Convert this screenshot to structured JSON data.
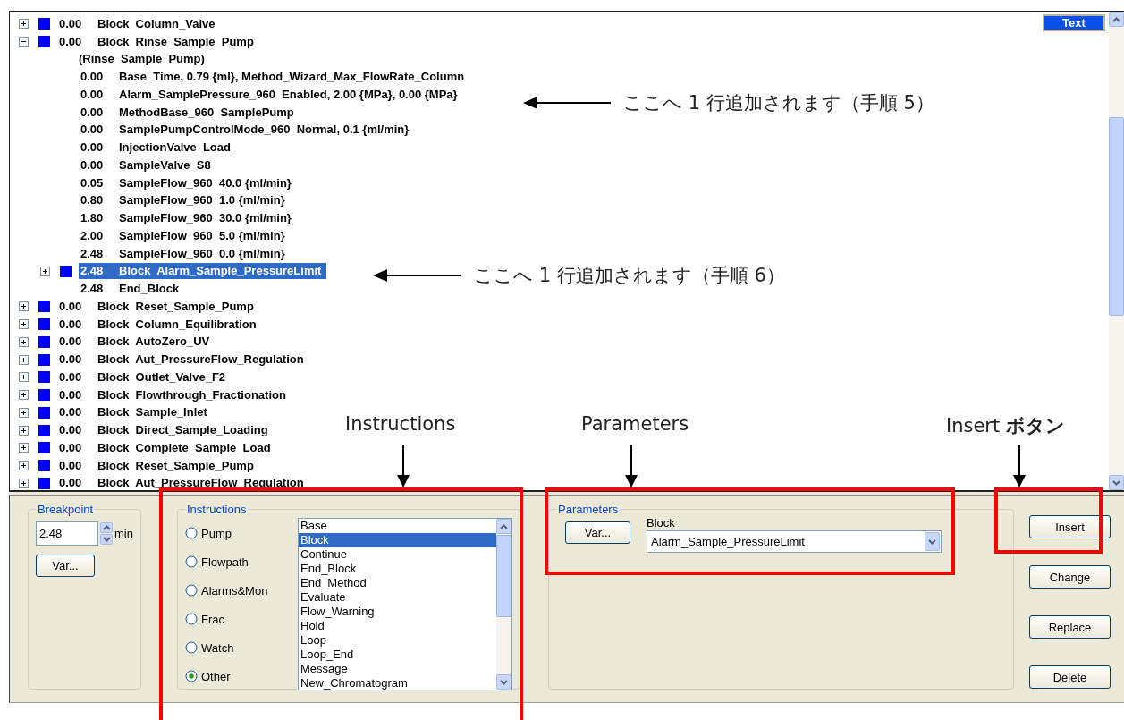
{
  "tree": [
    {
      "kind": "block",
      "time": "0.00",
      "text": "Block  Column_Valve",
      "expanded": false,
      "selected": false
    },
    {
      "kind": "block",
      "time": "0.00",
      "text": "Block  Rinse_Sample_Pump",
      "expanded": true,
      "selected": false,
      "children": [
        {
          "kind": "label",
          "text": "(Rinse_Sample_Pump)",
          "selected": false
        },
        {
          "kind": "step",
          "time": "0.00",
          "text": "Base  Time, 0.79 {ml}, Method_Wizard_Max_FlowRate_Column",
          "selected": false
        },
        {
          "kind": "step",
          "time": "0.00",
          "text": "Alarm_SamplePressure_960  Enabled, 2.00 {MPa}, 0.00 {MPa}",
          "selected": false
        },
        {
          "kind": "step",
          "time": "0.00",
          "text": "MethodBase_960  SamplePump",
          "selected": false
        },
        {
          "kind": "step",
          "time": "0.00",
          "text": "SamplePumpControlMode_960  Normal, 0.1 {ml/min}",
          "selected": false
        },
        {
          "kind": "step",
          "time": "0.00",
          "text": "InjectionValve  Load",
          "selected": false
        },
        {
          "kind": "step",
          "time": "0.00",
          "text": "SampleValve  S8",
          "selected": false
        },
        {
          "kind": "step",
          "time": "0.05",
          "text": "SampleFlow_960  40.0 {ml/min}",
          "selected": false
        },
        {
          "kind": "step",
          "time": "0.80",
          "text": "SampleFlow_960  1.0 {ml/min}",
          "selected": false
        },
        {
          "kind": "step",
          "time": "1.80",
          "text": "SampleFlow_960  30.0 {ml/min}",
          "selected": false
        },
        {
          "kind": "step",
          "time": "2.00",
          "text": "SampleFlow_960  5.0 {ml/min}",
          "selected": false
        },
        {
          "kind": "step",
          "time": "2.48",
          "text": "SampleFlow_960  0.0 {ml/min}",
          "selected": false
        },
        {
          "kind": "block",
          "time": "2.48",
          "text": "Block  Alarm_Sample_PressureLimit",
          "expanded": false,
          "selected": true
        },
        {
          "kind": "step",
          "time": "2.48",
          "text": "End_Block",
          "selected": false
        }
      ]
    },
    {
      "kind": "block",
      "time": "0.00",
      "text": "Block  Reset_Sample_Pump",
      "expanded": false,
      "selected": false
    },
    {
      "kind": "block",
      "time": "0.00",
      "text": "Block  Column_Equilibration",
      "expanded": false,
      "selected": false
    },
    {
      "kind": "block",
      "time": "0.00",
      "text": "Block  AutoZero_UV",
      "expanded": false,
      "selected": false
    },
    {
      "kind": "block",
      "time": "0.00",
      "text": "Block  Aut_PressureFlow_Regulation",
      "expanded": false,
      "selected": false
    },
    {
      "kind": "block",
      "time": "0.00",
      "text": "Block  Outlet_Valve_F2",
      "expanded": false,
      "selected": false
    },
    {
      "kind": "block",
      "time": "0.00",
      "text": "Block  Flowthrough_Fractionation",
      "expanded": false,
      "selected": false
    },
    {
      "kind": "block",
      "time": "0.00",
      "text": "Block  Sample_Inlet",
      "expanded": false,
      "selected": false
    },
    {
      "kind": "block",
      "time": "0.00",
      "text": "Block  Direct_Sample_Loading",
      "expanded": false,
      "selected": false
    },
    {
      "kind": "block",
      "time": "0.00",
      "text": "Block  Complete_Sample_Load",
      "expanded": false,
      "selected": false
    },
    {
      "kind": "block",
      "time": "0.00",
      "text": "Block  Reset_Sample_Pump",
      "expanded": false,
      "selected": false
    },
    {
      "kind": "block",
      "time": "0.00",
      "text": "Block  Aut_PressureFlow_Regulation",
      "expanded": false,
      "selected": false
    }
  ],
  "view_button": "Text",
  "breakpoint": {
    "title": "Breakpoint",
    "value": "2.48",
    "unit": "min",
    "var_button": "Var..."
  },
  "instructions": {
    "title": "Instructions",
    "radios": [
      {
        "label": "Pump",
        "selected": false
      },
      {
        "label": "Flowpath",
        "selected": false
      },
      {
        "label": "Alarms&Mon",
        "selected": false
      },
      {
        "label": "Frac",
        "selected": false
      },
      {
        "label": "Watch",
        "selected": false
      },
      {
        "label": "Other",
        "selected": true
      }
    ],
    "list": [
      {
        "label": "Base",
        "selected": false
      },
      {
        "label": "Block",
        "selected": true
      },
      {
        "label": "Continue",
        "selected": false
      },
      {
        "label": "End_Block",
        "selected": false
      },
      {
        "label": "End_Method",
        "selected": false
      },
      {
        "label": "Evaluate",
        "selected": false
      },
      {
        "label": "Flow_Warning",
        "selected": false
      },
      {
        "label": "Hold",
        "selected": false
      },
      {
        "label": "Loop",
        "selected": false
      },
      {
        "label": "Loop_End",
        "selected": false
      },
      {
        "label": "Message",
        "selected": false
      },
      {
        "label": "New_Chromatogram",
        "selected": false
      }
    ]
  },
  "parameters": {
    "title": "Parameters",
    "var_button": "Var...",
    "field_label": "Block",
    "value": "Alarm_Sample_PressureLimit"
  },
  "buttons": [
    "Insert",
    "Change",
    "Replace",
    "Delete"
  ],
  "annotations": {
    "notes": [
      "ここへ 1 行追加されます（手順 5）",
      "ここへ 1 行追加されます（手順 6）"
    ],
    "callouts": [
      "Instructions",
      "Parameters",
      "Insert **ボタン**"
    ]
  }
}
